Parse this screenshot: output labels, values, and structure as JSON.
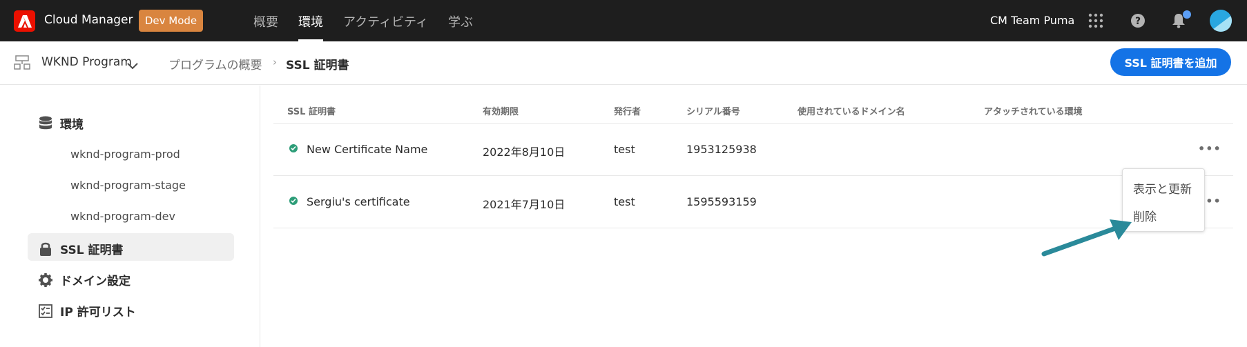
{
  "topbar": {
    "app_title": "Cloud Manager",
    "dev_mode_label": "Dev Mode",
    "nav": [
      "概要",
      "環境",
      "アクティビティ",
      "学ぶ"
    ],
    "active_nav": "環境",
    "team_name": "CM Team Puma",
    "icons": [
      "apps-grid-icon",
      "help-icon",
      "bell-icon",
      "avatar"
    ]
  },
  "subheader": {
    "program_name": "WKND Program",
    "breadcrumb": {
      "link": "プログラムの概要",
      "current": "SSL 証明書"
    },
    "add_button_label": "SSL 証明書を追加"
  },
  "sidebar": {
    "environments_label": "環境",
    "environments": [
      "wknd-program-prod",
      "wknd-program-stage",
      "wknd-program-dev"
    ],
    "ssl_label": "SSL 証明書",
    "domain_label": "ドメイン設定",
    "ip_label": "IP 許可リスト"
  },
  "table": {
    "headers": [
      "SSL 証明書",
      "有効期限",
      "発行者",
      "シリアル番号",
      "使用されているドメイン名",
      "アタッチされている環境"
    ],
    "rows": [
      {
        "name": "New Certificate Name",
        "expiry": "2022年8月10日",
        "issuer": "test",
        "serial": "1953125938",
        "domains": "",
        "environments": ""
      },
      {
        "name": "Sergiu's certificate",
        "expiry": "2021年7月10日",
        "issuer": "test",
        "serial": "1595593159",
        "domains": "",
        "environments": ""
      }
    ]
  },
  "popover": {
    "items": [
      "表示と更新",
      "削除"
    ]
  },
  "colors": {
    "accent": "#1473e6",
    "dev_mode": "#d9853f",
    "status_ok": "#2d9d78",
    "annotation_arrow": "#2a8a9a"
  }
}
